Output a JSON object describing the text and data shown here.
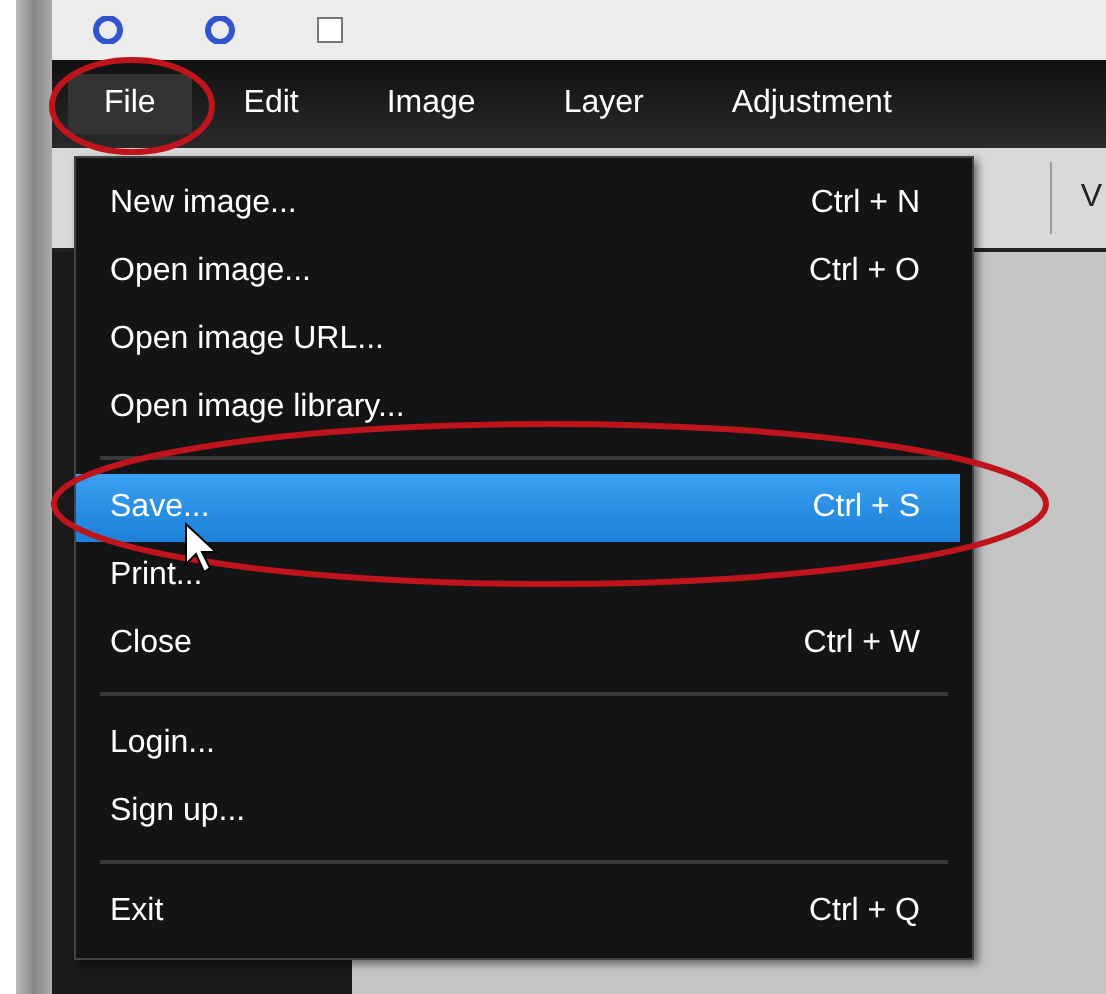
{
  "menubar": [
    {
      "label": "File",
      "selected": true
    },
    {
      "label": "Edit",
      "selected": false
    },
    {
      "label": "Image",
      "selected": false
    },
    {
      "label": "Layer",
      "selected": false
    },
    {
      "label": "Adjustment",
      "selected": false
    }
  ],
  "toolbar": {
    "cut_label": "V"
  },
  "file_menu": [
    {
      "kind": "item",
      "label": "New image...",
      "shortcut": "Ctrl + N",
      "selected": false
    },
    {
      "kind": "item",
      "label": "Open image...",
      "shortcut": "Ctrl + O",
      "selected": false
    },
    {
      "kind": "item",
      "label": "Open image URL...",
      "selected": false
    },
    {
      "kind": "item",
      "label": "Open image library...",
      "selected": false
    },
    {
      "kind": "separator"
    },
    {
      "kind": "item",
      "label": "Save...",
      "shortcut": "Ctrl + S",
      "selected": true
    },
    {
      "kind": "item",
      "label": "Print...",
      "selected": false
    },
    {
      "kind": "item",
      "label": "Close",
      "shortcut": "Ctrl + W",
      "selected": false
    },
    {
      "kind": "separator"
    },
    {
      "kind": "item",
      "label": "Login...",
      "selected": false
    },
    {
      "kind": "item",
      "label": "Sign up...",
      "selected": false
    },
    {
      "kind": "separator"
    },
    {
      "kind": "item",
      "label": "Exit",
      "shortcut": "Ctrl + Q",
      "selected": false
    }
  ]
}
